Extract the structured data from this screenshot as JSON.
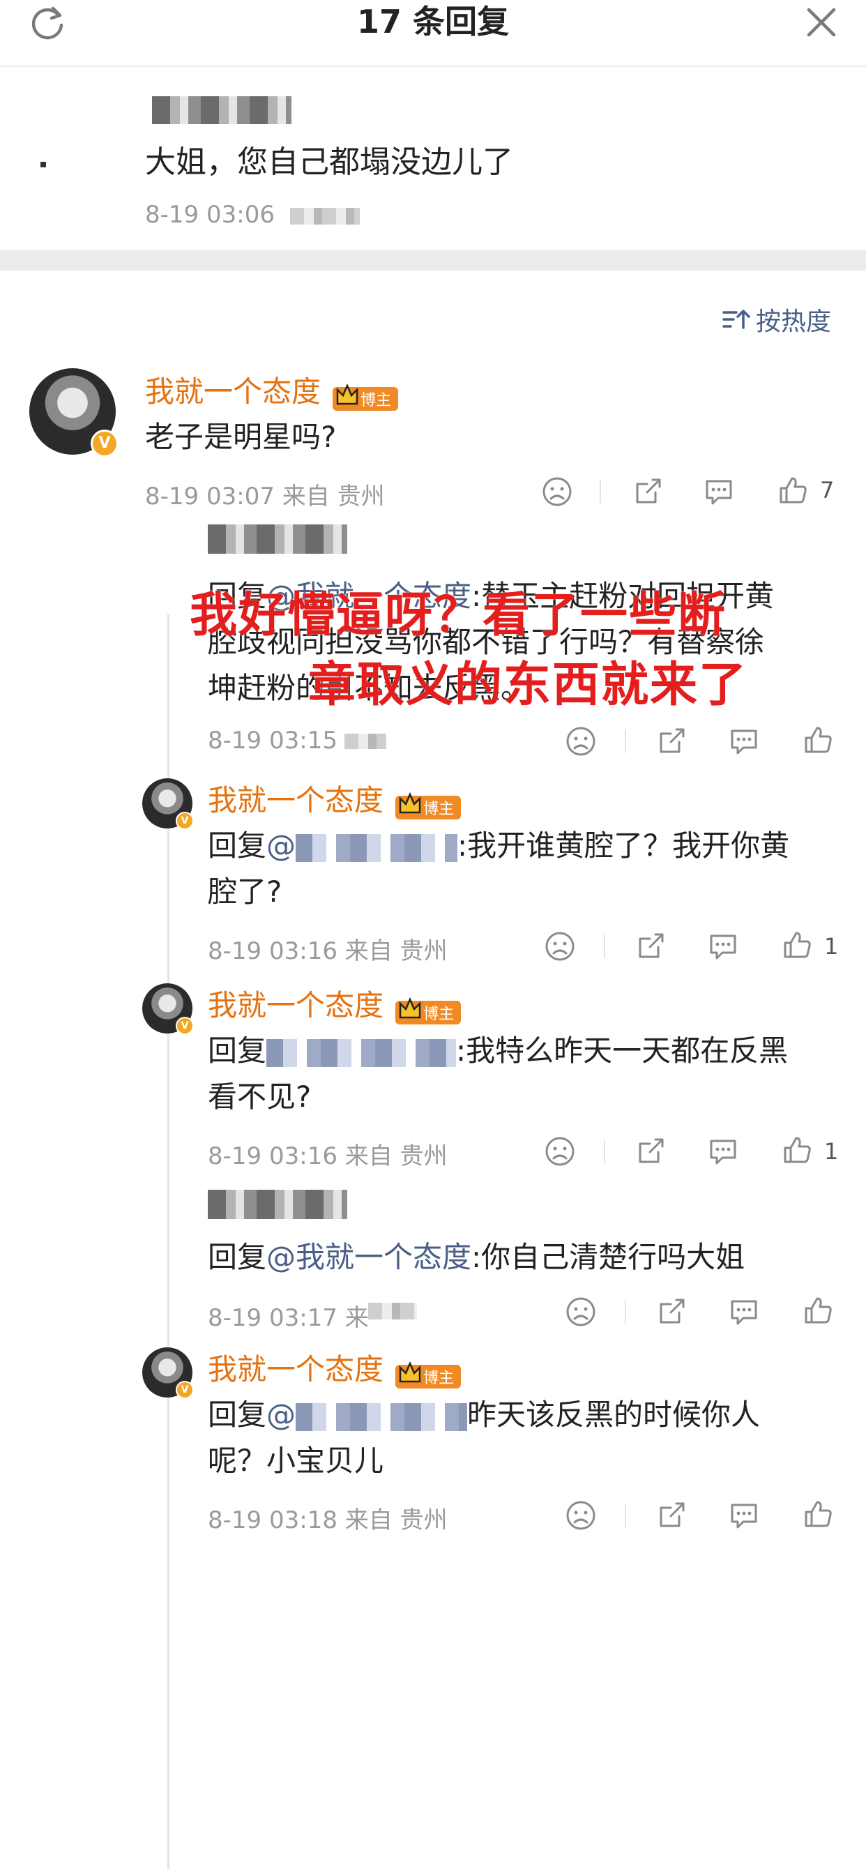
{
  "header": {
    "title": "17 条回复"
  },
  "original": {
    "text": "大姐，您自己都塌没边儿了",
    "time": "8-19 03:06"
  },
  "sort": {
    "label": "按热度"
  },
  "comments": [
    {
      "username": "我就一个态度",
      "badge": "博主",
      "text": "老子是明星吗?",
      "meta": "8-19 03:07 来自 贵州",
      "likes": "7"
    },
    {
      "reply_prefix": "回复",
      "mention": "@我就一个态度",
      "lines": [
        ":替玉主赶粉对回担开黄",
        "腔歧视同担没骂你都不错了行吗？有替察徐",
        "坤赶粉的引不知去反黑。"
      ],
      "meta": "8-19 03:15"
    },
    {
      "username": "我就一个态度",
      "badge": "博主",
      "reply_prefix": "回复",
      "mention": "@",
      "lines": [
        ":我开谁黄腔了？我开你黄",
        "腔了?"
      ],
      "meta": "8-19 03:16 来自 贵州",
      "likes": "1"
    },
    {
      "username": "我就一个态度",
      "badge": "博主",
      "reply_prefix": "回复",
      "lines": [
        ":我特么昨天一天都在反黑",
        "看不见?"
      ],
      "meta": "8-19 03:16 来自 贵州",
      "likes": "1"
    },
    {
      "reply_prefix": "回复",
      "mention": "@我就一个态度",
      "lines": [
        ":你自己清楚行吗大姐"
      ],
      "meta": "8-19 03:17 来"
    },
    {
      "username": "我就一个态度",
      "badge": "博主",
      "reply_prefix": "回复",
      "mention": "@",
      "lines": [
        "昨天该反黑的时候你人",
        "呢？小宝贝儿"
      ],
      "meta": "8-19 03:18 来自 贵州"
    }
  ],
  "overlay": {
    "line1": "我好懵逼呀？看了一些断",
    "line2": "章取义的东西就来了"
  },
  "colors": {
    "username": "#e5720f",
    "mention": "#4a5f87",
    "meta": "#9a9a9a",
    "overlay": "#e41d1d",
    "badge": "#f08a24"
  },
  "icons": [
    "refresh-icon",
    "close-icon",
    "sort-icon",
    "dislike-icon",
    "share-icon",
    "comment-icon",
    "like-icon",
    "crown-icon",
    "verified-icon"
  ]
}
